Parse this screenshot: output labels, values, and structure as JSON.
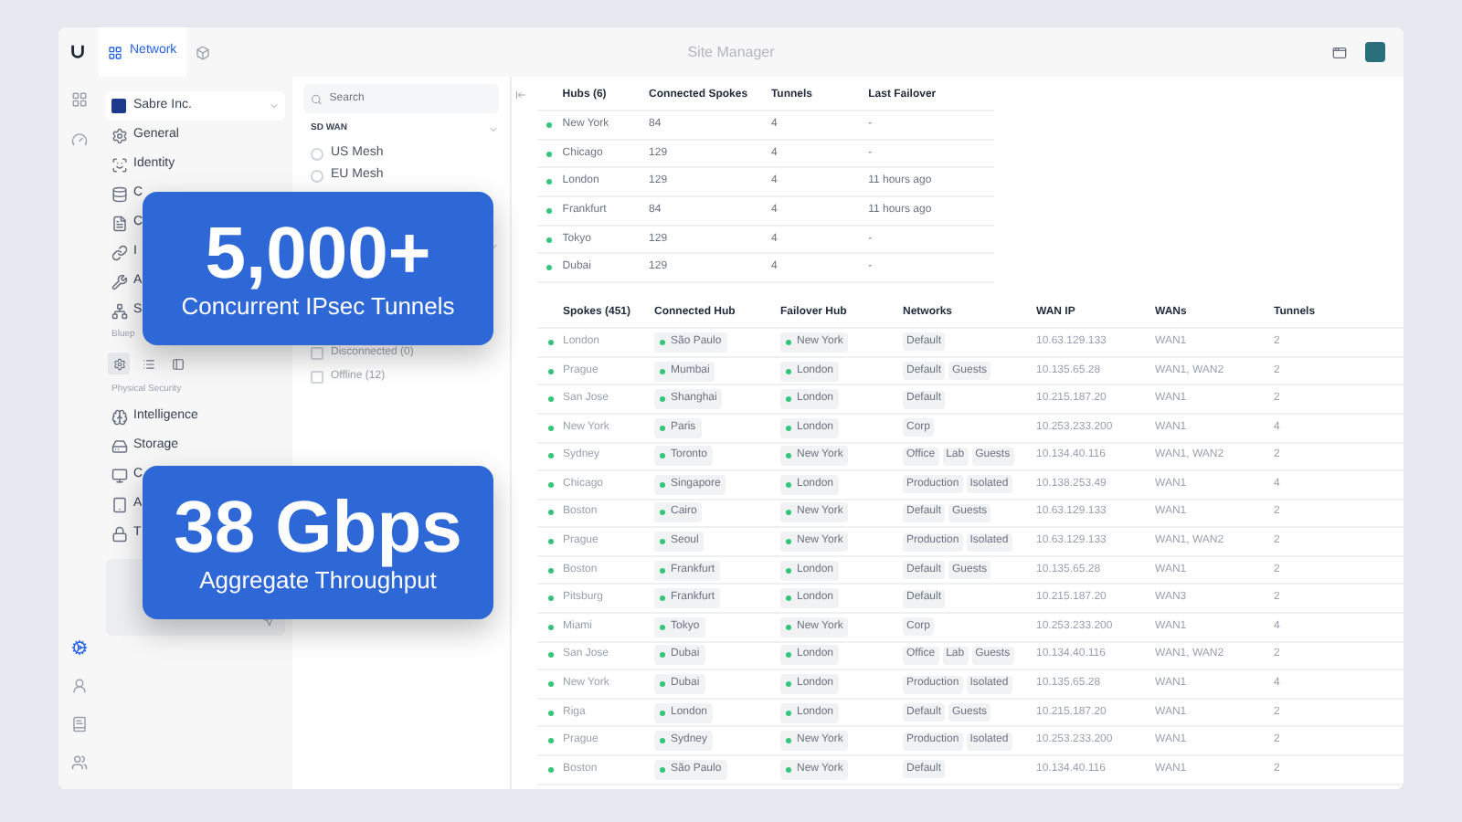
{
  "top_bar": {
    "title": "Site Manager",
    "tabs": [
      {
        "label": "Network",
        "selected": true
      }
    ]
  },
  "sidebar": {
    "organization": "Sabre Inc.",
    "items": [
      {
        "label": "General"
      },
      {
        "label": "Identity"
      },
      {
        "label": "C"
      },
      {
        "label": "C"
      },
      {
        "label": "I"
      },
      {
        "label": "A"
      },
      {
        "label": "S"
      }
    ],
    "section_label": "Bluep",
    "view_buttons": [
      {
        "selected": true
      },
      {
        "selected": false
      },
      {
        "selected": false
      }
    ],
    "physical_security": {
      "label": "Physical Security",
      "items": [
        {
          "label": "Intelligence"
        },
        {
          "label": "Storage"
        },
        {
          "label": "C"
        },
        {
          "label": "A"
        },
        {
          "label": "T"
        }
      ]
    }
  },
  "filter_panel": {
    "search": {
      "placeholder": "Search"
    },
    "section": "SD WAN",
    "topologies": [
      {
        "label": "US Mesh",
        "selected": false
      },
      {
        "label": "EU Mesh",
        "selected": false
      }
    ],
    "status_filters": [
      {
        "label": "Disconnected (0)",
        "checked": false
      },
      {
        "label": "Offline (12)",
        "checked": false
      }
    ]
  },
  "hubs_table": {
    "columns": [
      "Hubs (6)",
      "Connected Spokes",
      "Tunnels",
      "Last Failover"
    ],
    "rows": [
      [
        "New York",
        "84",
        "4",
        "-"
      ],
      [
        "Chicago",
        "129",
        "4",
        "-"
      ],
      [
        "London",
        "129",
        "4",
        "11 hours ago"
      ],
      [
        "Frankfurt",
        "84",
        "4",
        "11 hours ago"
      ],
      [
        "Tokyo",
        "129",
        "4",
        "-"
      ],
      [
        "Dubai",
        "129",
        "4",
        "-"
      ]
    ]
  },
  "spokes_table": {
    "columns": [
      "Spokes (451)",
      "Connected Hub",
      "Failover Hub",
      "Networks",
      "WAN IP",
      "WANs",
      "Tunnels"
    ],
    "rows": [
      {
        "name": "London",
        "hub": "São Paulo",
        "failover": "New York",
        "networks": [
          "Default"
        ],
        "wan_ip": "10.63.129.133",
        "wans": "WAN1",
        "tunnels": "2"
      },
      {
        "name": "Prague",
        "hub": "Mumbai",
        "failover": "London",
        "networks": [
          "Default",
          "Guests"
        ],
        "wan_ip": "10.135.65.28",
        "wans": "WAN1, WAN2",
        "tunnels": "2"
      },
      {
        "name": "San Jose",
        "hub": "Shanghai",
        "failover": "London",
        "networks": [
          "Default"
        ],
        "wan_ip": "10.215.187.20",
        "wans": "WAN1",
        "tunnels": "2"
      },
      {
        "name": "New York",
        "hub": "Paris",
        "failover": "London",
        "networks": [
          "Corp"
        ],
        "wan_ip": "10.253.233.200",
        "wans": "WAN1",
        "tunnels": "4"
      },
      {
        "name": "Sydney",
        "hub": "Toronto",
        "failover": "New York",
        "networks": [
          "Office",
          "Lab",
          "Guests"
        ],
        "wan_ip": "10.134.40.116",
        "wans": "WAN1, WAN2",
        "tunnels": "2"
      },
      {
        "name": "Chicago",
        "hub": "Singapore",
        "failover": "London",
        "networks": [
          "Production",
          "Isolated"
        ],
        "wan_ip": "10.138.253.49",
        "wans": "WAN1",
        "tunnels": "4"
      },
      {
        "name": "Boston",
        "hub": "Cairo",
        "failover": "New York",
        "networks": [
          "Default",
          "Guests"
        ],
        "wan_ip": "10.63.129.133",
        "wans": "WAN1",
        "tunnels": "2"
      },
      {
        "name": "Prague",
        "hub": "Seoul",
        "failover": "New York",
        "networks": [
          "Production",
          "Isolated"
        ],
        "wan_ip": "10.63.129.133",
        "wans": "WAN1, WAN2",
        "tunnels": "2"
      },
      {
        "name": "Boston",
        "hub": "Frankfurt",
        "failover": "London",
        "networks": [
          "Default",
          "Guests"
        ],
        "wan_ip": "10.135.65.28",
        "wans": "WAN1",
        "tunnels": "2"
      },
      {
        "name": "Pitsburg",
        "hub": "Frankfurt",
        "failover": "London",
        "networks": [
          "Default"
        ],
        "wan_ip": "10.215.187.20",
        "wans": "WAN3",
        "tunnels": "2"
      },
      {
        "name": "Miami",
        "hub": "Tokyo",
        "failover": "New York",
        "networks": [
          "Corp"
        ],
        "wan_ip": "10.253.233.200",
        "wans": "WAN1",
        "tunnels": "4"
      },
      {
        "name": "San Jose",
        "hub": "Dubai",
        "failover": "London",
        "networks": [
          "Office",
          "Lab",
          "Guests"
        ],
        "wan_ip": "10.134.40.116",
        "wans": "WAN1, WAN2",
        "tunnels": "2"
      },
      {
        "name": "New York",
        "hub": "Dubai",
        "failover": "London",
        "networks": [
          "Production",
          "Isolated"
        ],
        "wan_ip": "10.135.65.28",
        "wans": "WAN1",
        "tunnels": "4"
      },
      {
        "name": "Riga",
        "hub": "London",
        "failover": "London",
        "networks": [
          "Default",
          "Guests"
        ],
        "wan_ip": "10.215.187.20",
        "wans": "WAN1",
        "tunnels": "2"
      },
      {
        "name": "Prague",
        "hub": "Sydney",
        "failover": "New York",
        "networks": [
          "Production",
          "Isolated"
        ],
        "wan_ip": "10.253.233.200",
        "wans": "WAN1",
        "tunnels": "2"
      },
      {
        "name": "Boston",
        "hub": "São Paulo",
        "failover": "New York",
        "networks": [
          "Default"
        ],
        "wan_ip": "10.134.40.116",
        "wans": "WAN1",
        "tunnels": "2"
      }
    ]
  },
  "callouts": [
    {
      "value": "5,000+",
      "caption": "Concurrent IPsec Tunnels"
    },
    {
      "value": "38 Gbps",
      "caption": "Aggregate Throughput"
    }
  ]
}
